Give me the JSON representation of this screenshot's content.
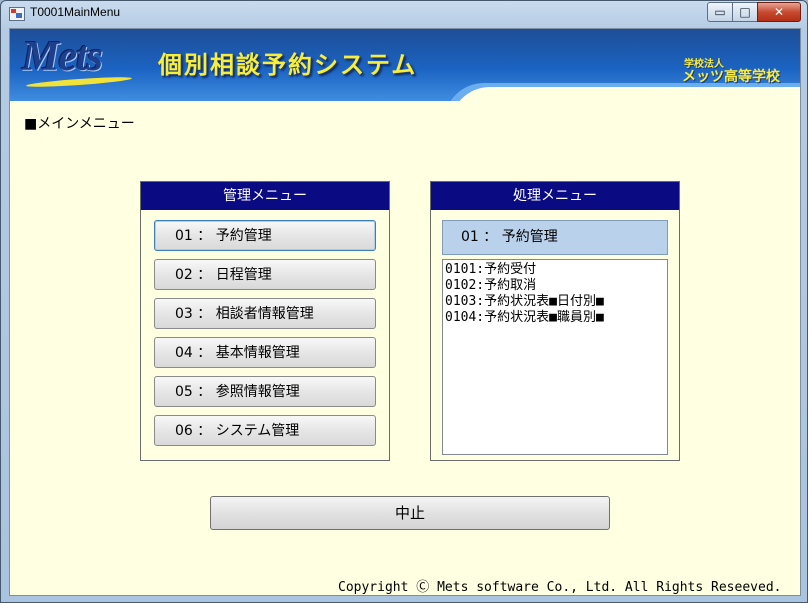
{
  "window": {
    "title": "T0001MainMenu",
    "controls": {
      "minimize": "▭",
      "maximize": "□",
      "close": "✕"
    }
  },
  "banner": {
    "logo": "Mets",
    "system_title": "個別相談予約システム",
    "school_sub": "学校法人",
    "school_name": "メッツ高等学校"
  },
  "main_heading": "■メインメニュー",
  "management_menu": {
    "title": "管理メニュー",
    "items": [
      {
        "label": "01 ： 予約管理"
      },
      {
        "label": "02 ： 日程管理"
      },
      {
        "label": "03 ： 相談者情報管理"
      },
      {
        "label": "04 ： 基本情報管理"
      },
      {
        "label": "05 ： 参照情報管理"
      },
      {
        "label": "06 ： システム管理"
      }
    ]
  },
  "process_menu": {
    "title": "処理メニュー",
    "selected": "01 ： 予約管理",
    "items": [
      {
        "label": "0101:予約受付"
      },
      {
        "label": "0102:予約取消"
      },
      {
        "label": "0103:予約状況表■日付別■"
      },
      {
        "label": "0104:予約状況表■職員別■"
      }
    ]
  },
  "cancel_button": "中止",
  "copyright": "Copyright Ⓒ Mets software Co., Ltd. All Rights Reseeved.",
  "colors": {
    "panel_header": "#0a0a82",
    "client_background": "#ffffe1",
    "banner_blue": "#1b63c2",
    "title_yellow": "#f6ee3a",
    "selected_menu": "#b9d1ea"
  }
}
